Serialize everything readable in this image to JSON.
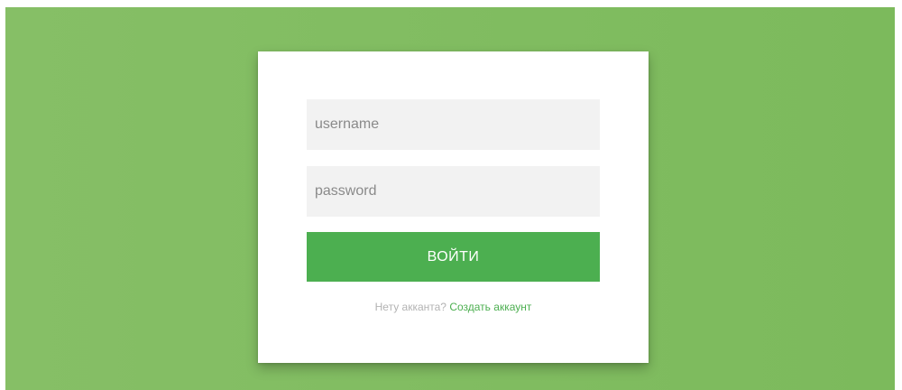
{
  "login_form": {
    "username_placeholder": "username",
    "password_placeholder": "password",
    "submit_label": "ВОЙТИ",
    "signup_prompt": "Нету акканта?",
    "signup_link": "Создать аккаунт"
  },
  "colors": {
    "background_gradient_start": "#86bf66",
    "background_gradient_end": "#7cba5c",
    "card_background": "#ffffff",
    "field_background": "#f2f2f2",
    "accent": "#4caf50",
    "muted_text": "#b3b3b3"
  }
}
